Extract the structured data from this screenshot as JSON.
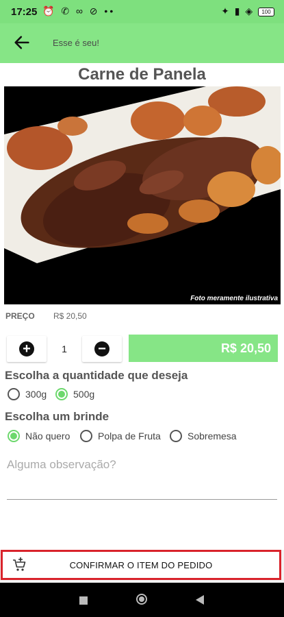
{
  "status_bar": {
    "time": "17:25",
    "left_icons": "⏰ ✆ ∞ ⊘ ••",
    "right_icons": "✦ ▮ ◈",
    "battery": "100"
  },
  "app_bar": {
    "title": "Esse é seu!"
  },
  "product": {
    "name": "Carne de Panela",
    "photo_caption": "Foto meramente ilustrativa",
    "price_label": "PREÇO",
    "price_value": "R$ 20,50"
  },
  "order": {
    "plus": "+",
    "minus": "−",
    "quantity": "1",
    "total": "R$ 20,50"
  },
  "quantity_section": {
    "title": "Escolha a quantidade que deseja",
    "options": [
      {
        "label": "300g",
        "selected": false
      },
      {
        "label": "500g",
        "selected": true
      }
    ]
  },
  "gift_section": {
    "title": "Escolha um brinde",
    "options": [
      {
        "label": "Não quero",
        "selected": true
      },
      {
        "label": "Polpa de Fruta",
        "selected": false
      },
      {
        "label": "Sobremesa",
        "selected": false
      }
    ]
  },
  "observation": {
    "placeholder": "Alguma observação?"
  },
  "confirm": {
    "label": "CONFIRMAR O ITEM DO PEDIDO"
  },
  "colors": {
    "accent": "#86e586",
    "confirm_border": "#d9232b",
    "radio_on": "#6dd86d"
  }
}
